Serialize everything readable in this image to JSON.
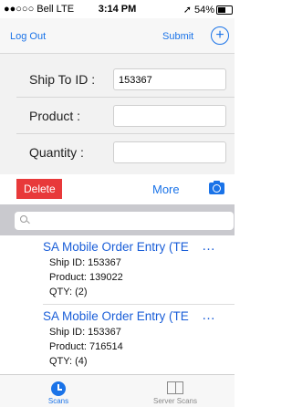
{
  "status_bar": {
    "carrier": "●●○○○ Bell  LTE",
    "time": "3:14 PM",
    "battery": "➚ 54%",
    "battery_level": 0.54
  },
  "navbar": {
    "logout_label": "Log Out",
    "submit_label": "Submit",
    "add_icon": "plus-circle-icon",
    "add_glyph": "+"
  },
  "form": {
    "ship_to": {
      "label": "Ship To ID :",
      "value": "153367"
    },
    "product": {
      "label": "Product :",
      "value": ""
    },
    "quantity": {
      "label": "Quantity :",
      "value": ""
    }
  },
  "actions": {
    "delete_label": "Delete",
    "more_label": "More",
    "camera_icon": "camera-icon"
  },
  "search": {
    "placeholder": "",
    "icon": "search-icon"
  },
  "orders": [
    {
      "title": "SA Mobile Order Entry (TE",
      "ellipsis": "…",
      "ship": "Ship ID: 153367",
      "product": "Product: 139022",
      "qty": "QTY: (2)"
    },
    {
      "title": "SA Mobile Order Entry (TE",
      "ellipsis": "…",
      "ship": "Ship ID: 153367",
      "product": "Product: 716514",
      "qty": "QTY: (4)"
    }
  ],
  "tabs": [
    {
      "label": "Scans",
      "icon": "clock-icon",
      "active": true
    },
    {
      "label": "Server Scans",
      "icon": "book-icon",
      "active": false
    }
  ],
  "colors": {
    "accent": "#1a73e8",
    "delete": "#e8393a",
    "title": "#1a5ed8"
  }
}
